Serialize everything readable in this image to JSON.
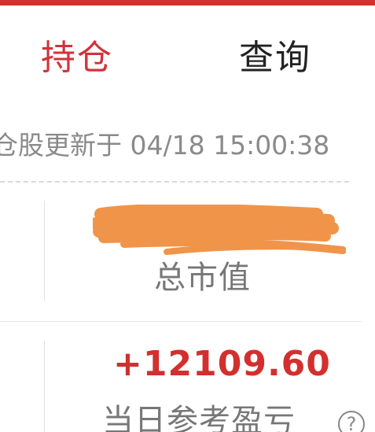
{
  "tabs": [
    {
      "label": "持仓",
      "active": true
    },
    {
      "label": "查询",
      "active": false
    }
  ],
  "holdings": {
    "update_text": "仓股更新于 04/18 15:00:38",
    "total_value_label": "总市值",
    "total_value": "",
    "daily_pnl": "+12109.60",
    "daily_pnl_label": "当日参考盈亏",
    "help_glyph": "?"
  },
  "colors": {
    "accent": "#d32f2f",
    "redaction": "#f0944a"
  }
}
